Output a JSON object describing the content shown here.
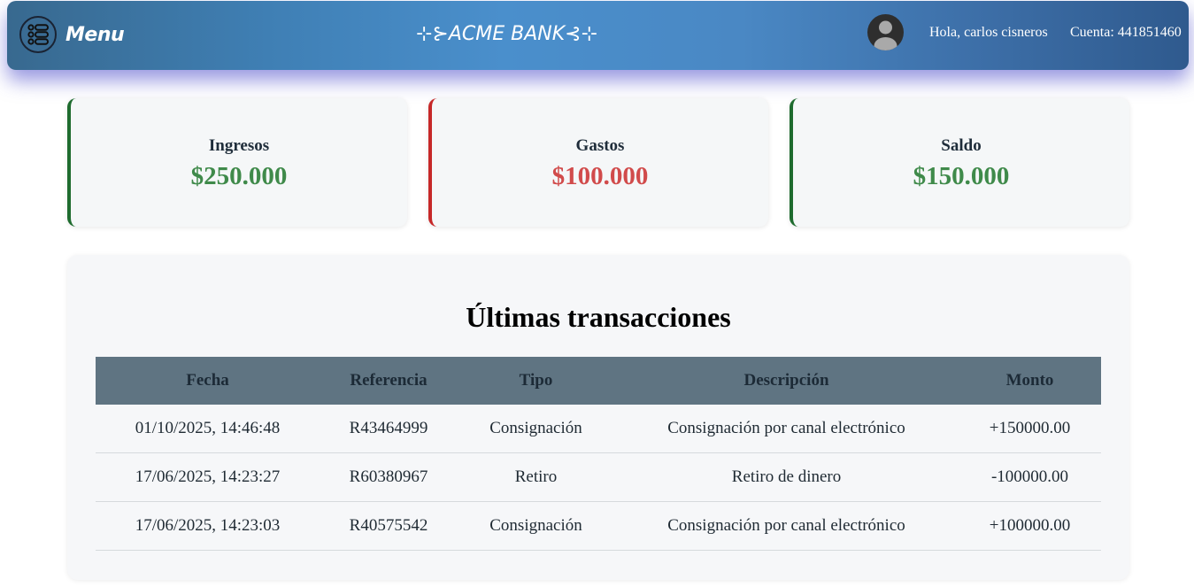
{
  "header": {
    "menu_label": "Menu",
    "brand": "⊹⊱ACME BANK⊰⊹",
    "greeting": "Hola, carlos cisneros",
    "account": "Cuenta: 441851460"
  },
  "summary": {
    "income": {
      "title": "Ingresos",
      "value": "$250.000"
    },
    "expenses": {
      "title": "Gastos",
      "value": "$100.000"
    },
    "balance": {
      "title": "Saldo",
      "value": "$150.000"
    }
  },
  "transactions": {
    "title": "Últimas transacciones",
    "columns": [
      "Fecha",
      "Referencia",
      "Tipo",
      "Descripción",
      "Monto"
    ],
    "rows": [
      [
        "01/10/2025, 14:46:48",
        "R43464999",
        "Consignación",
        "Consignación por canal electrónico",
        "+150000.00"
      ],
      [
        "17/06/2025, 14:23:27",
        "R60380967",
        "Retiro",
        "Retiro de dinero",
        "-100000.00"
      ],
      [
        "17/06/2025, 14:23:03",
        "R40575542",
        "Consignación",
        "Consignación por canal electrónico",
        "+100000.00"
      ]
    ]
  },
  "colors": {
    "positive": "#3f8a4a",
    "negative": "#d14b4b",
    "table_header": "#5f7482"
  },
  "icons": {
    "menu": "menu-list-icon",
    "avatar": "user-avatar-icon"
  }
}
